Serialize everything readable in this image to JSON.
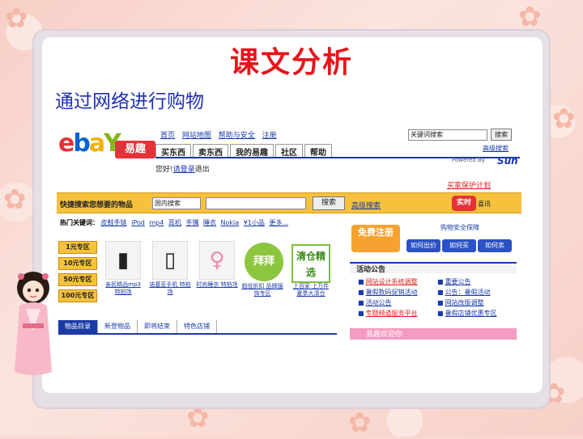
{
  "slide": {
    "title": "课文分析",
    "subtitle": "通过网络进行购物"
  },
  "ebay": {
    "logo": {
      "e": "e",
      "b": "b",
      "a": "a",
      "y": "Y",
      "cn": "易趣"
    },
    "top_links": [
      "首页",
      "网站地图",
      "帮助与安全",
      "注册"
    ],
    "nav_tabs": [
      "买东西",
      "卖东西",
      "我的易趣",
      "社区",
      "帮助"
    ],
    "search_mini": "关键词搜索",
    "search_mini_btn": "搜索",
    "advanced_search_mini": "高级搜索",
    "powered": "Powered By",
    "sun": "Sun",
    "welcome": "您好!",
    "welcome_link": "请登录",
    "welcome_link2": "退出",
    "red_link": "买家保护计划",
    "search_label": "快捷搜索您想要的物品",
    "search_select": "国内搜索",
    "search_btn": "搜索",
    "search_adv": "高级搜索",
    "search_badge": "实时",
    "search_badge2": "喜讯",
    "hot_label": "热门关键词：",
    "hot_words": [
      "皮鞋手链",
      "iPod",
      "mp4",
      "耳机",
      "手镯",
      "睡衣",
      "Nokia",
      "¥1小品",
      "更多..."
    ],
    "zones": [
      "1元专区",
      "10元专区",
      "50元专区",
      "100元专区"
    ],
    "products": [
      {
        "label": "亲民精品mp3 特拍场"
      },
      {
        "label": "诺基亚手机 特拍场"
      },
      {
        "label": "时尚睡衣 特拍场"
      },
      {
        "label": "超低折扣 品牌服饰专区"
      },
      {
        "label": "上百家 上万件 夏季大清仓"
      }
    ],
    "green_badge": "拜拜",
    "clear_badge": "清仓精选",
    "free_register": "免费注册",
    "right_badge": "购物安全保障",
    "blue_buttons": [
      "如何出价",
      "如何买",
      "如何卖"
    ],
    "notice_title": "活动公告",
    "notices_left": [
      "网站设计系统调整",
      "暑假数码促销活动",
      "活动公告",
      "专题频道服务平台"
    ],
    "notices_right": [
      "重要公告",
      "公告：暑假活动",
      "网站改版调整",
      "暑假店铺优惠专区"
    ],
    "tabs": [
      "物品目录",
      "新登物品",
      "即将结束",
      "特色店铺"
    ],
    "banner": "易趣欢迎你"
  }
}
